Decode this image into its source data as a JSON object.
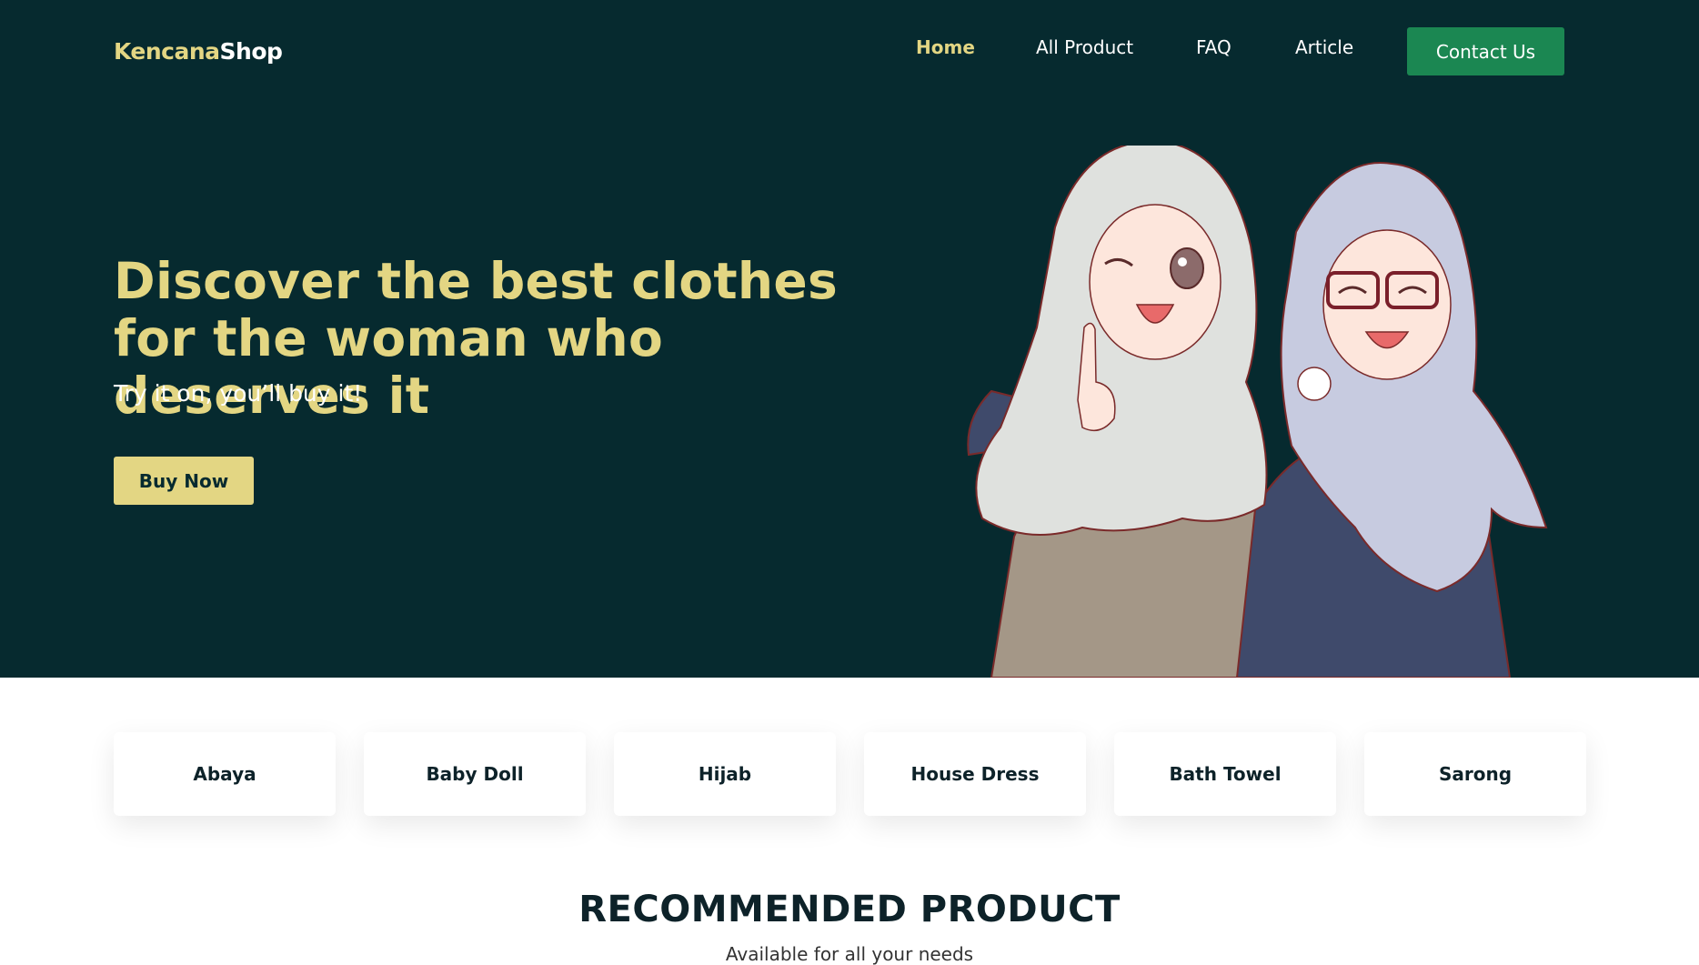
{
  "brand": {
    "part1": "Kencana",
    "part2": "Shop"
  },
  "nav": {
    "items": [
      {
        "label": "Home",
        "active": true
      },
      {
        "label": "All Product",
        "active": false
      },
      {
        "label": "FAQ",
        "active": false
      },
      {
        "label": "Article",
        "active": false
      }
    ],
    "contact_label": "Contact Us"
  },
  "hero": {
    "headline": "Discover the best clothes for the woman who deserves it",
    "subline": "Try it on, you’ll buy it!",
    "cta_label": "Buy Now"
  },
  "categories": [
    "Abaya",
    "Baby Doll",
    "Hijab",
    "House Dress",
    "Bath Towel",
    "Sarong"
  ],
  "recommended": {
    "title": "RECOMMENDED PRODUCT",
    "subtitle": "Available for all your needs"
  },
  "colors": {
    "hero_bg": "#062a2f",
    "accent_yellow": "#e3d683",
    "contact_green": "#1b8752",
    "dark_text": "#0d2229"
  }
}
